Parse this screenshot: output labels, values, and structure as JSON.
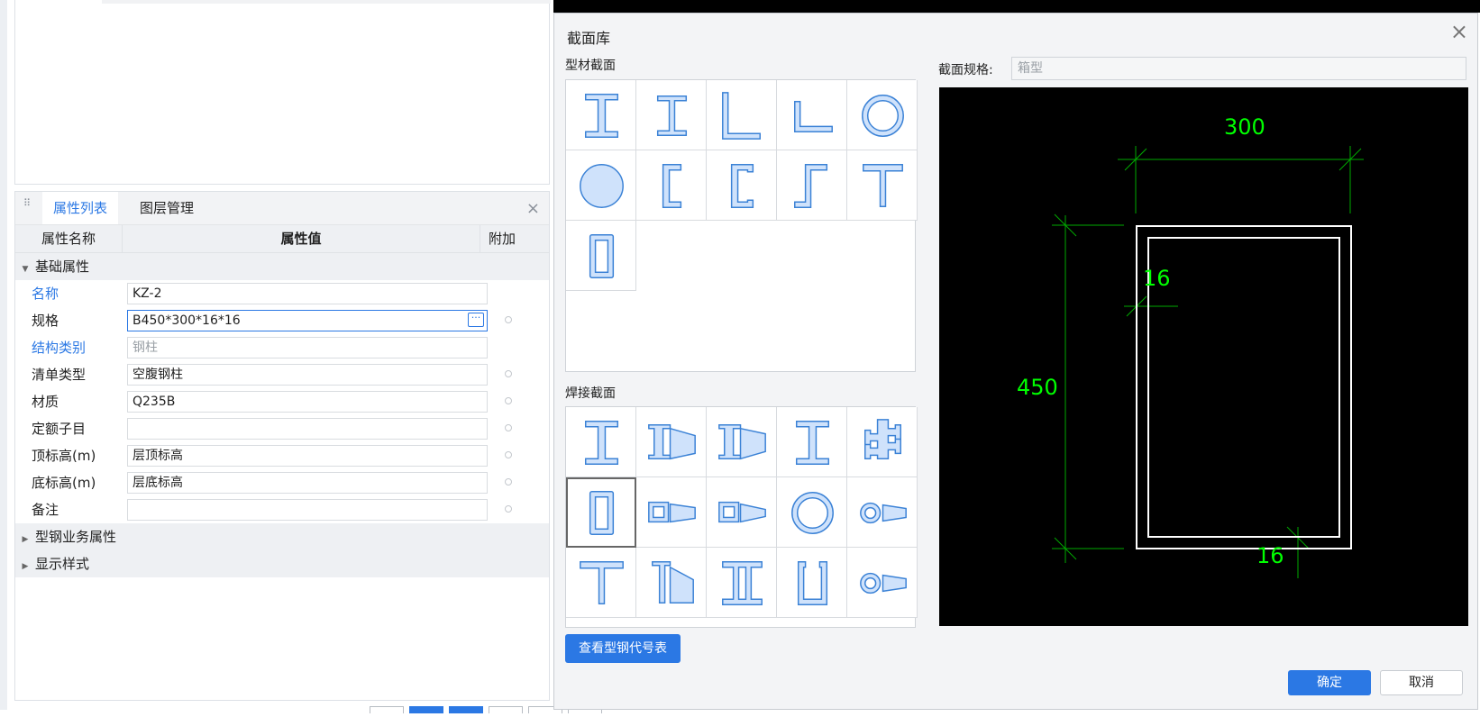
{
  "panel": {
    "tabs": [
      "属性列表",
      "图层管理"
    ],
    "close_glyph": "×",
    "columns": {
      "name": "属性名称",
      "value": "属性值",
      "extra": "附加"
    },
    "groups": {
      "basic": "基础属性",
      "steel": "型钢业务属性",
      "display": "显示样式"
    },
    "rows": [
      {
        "label": "名称",
        "value": "KZ-2",
        "label_color": "#2b78e4",
        "dot": false
      },
      {
        "label": "规格",
        "value": "B450*300*16*16",
        "active": true,
        "dot": true
      },
      {
        "label": "结构类别",
        "value": "钢柱",
        "label_color": "#2b78e4",
        "dot": false,
        "readonly": true
      },
      {
        "label": "清单类型",
        "value": "空腹钢柱",
        "dot": true
      },
      {
        "label": "材质",
        "value": "Q235B",
        "dot": true
      },
      {
        "label": "定额子目",
        "value": "",
        "dot": true
      },
      {
        "label": "顶标高(m)",
        "value": "层顶标高",
        "dot": true
      },
      {
        "label": "底标高(m)",
        "value": "层底标高",
        "dot": true
      },
      {
        "label": "备注",
        "value": "",
        "dot": true
      }
    ]
  },
  "dialog": {
    "title": "截面库",
    "close_glyph": "×",
    "section_profile": "型材截面",
    "section_welded": "焊接截面",
    "spec_label": "截面规格:",
    "spec_value": "箱型",
    "btn_table": "查看型钢代号表",
    "btn_ok": "确定",
    "btn_cancel": "取消",
    "profile_icons": [
      "i-beam-icon",
      "h-beam-icon",
      "equal-angle-icon",
      "unequal-angle-icon",
      "pipe-icon",
      "solid-round-icon",
      "channel-icon",
      "lipped-channel-icon",
      "z-section-icon",
      "t-section-icon",
      "box-section-icon"
    ],
    "welded_icons": [
      "welded-i-icon",
      "tapered-h-icon",
      "tapered-i-icon",
      "welded-h-icon",
      "cross-section-icon",
      "welded-box-icon",
      "box-tapered-icon",
      "box-tapered-2-icon",
      "welded-pipe-icon",
      "pipe-tapered-icon",
      "welded-t-icon",
      "tapered-t-icon",
      "double-i-icon",
      "u-section-icon",
      "pipe-tapered-2-icon"
    ],
    "selected_welded_index": 5,
    "preview": {
      "width_dim": "300",
      "height_dim": "450",
      "web_thk": "16",
      "flange_thk": "16",
      "dim_color": "#00ff00"
    }
  },
  "colors": {
    "accent": "#2b78e4",
    "icon_fill": "#cfe2fb",
    "icon_stroke": "#3b82d6"
  }
}
